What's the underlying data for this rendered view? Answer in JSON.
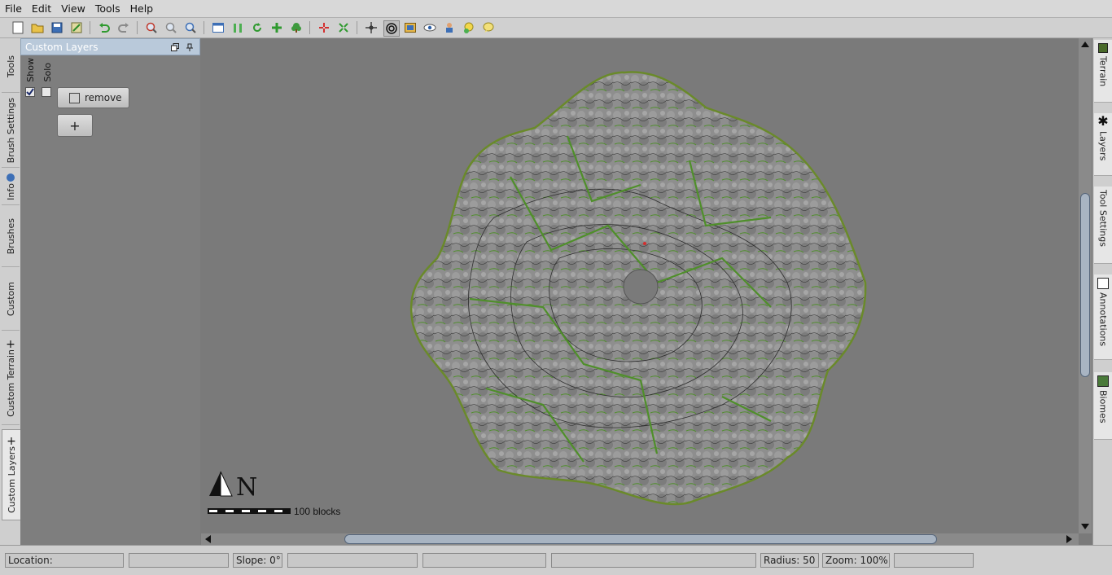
{
  "menu": {
    "file": "File",
    "edit": "Edit",
    "view": "View",
    "tools": "Tools",
    "help": "Help"
  },
  "left_tabs": [
    "Tools",
    "Brush Settings",
    "Info",
    "Brushes",
    "Custom",
    "Custom Terrain",
    "Custom Layers"
  ],
  "panel": {
    "title": "Custom Layers",
    "show_label": "Show",
    "solo_label": "Solo",
    "show_checked": true,
    "solo_checked": false,
    "remove_label": "remove",
    "add_label": "+"
  },
  "map": {
    "north_label": "N",
    "scale_label": "100 blocks"
  },
  "right_tabs": [
    "Terrain",
    "Layers",
    "Tool Settings",
    "Annotations",
    "Biomes"
  ],
  "status": {
    "location": "Location:",
    "field2": "",
    "slope": "Slope: 0°",
    "field4": "",
    "field5": "",
    "field6": "",
    "radius": "Radius: 50",
    "zoom": "Zoom: 100%",
    "field9": ""
  },
  "colors": {
    "background": "#7a7a7a",
    "terrain_rock": "#8c8c8c",
    "grass": "#4f8f2a",
    "panel_header": "#b9c9da"
  }
}
